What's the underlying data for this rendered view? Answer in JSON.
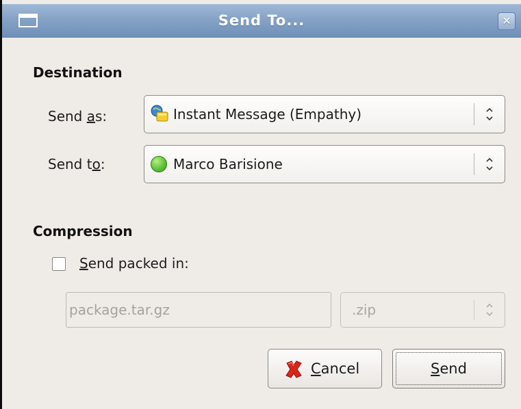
{
  "window": {
    "title": "Send To..."
  },
  "destination": {
    "heading": "Destination",
    "send_as": {
      "label_before": "Send ",
      "label_mnemonic": "a",
      "label_after": "s:",
      "value": "Instant Message (Empathy)",
      "icon": "instant-message-icon"
    },
    "send_to": {
      "label_before": "Send t",
      "label_mnemonic": "o",
      "label_after": ":",
      "value": "Marco Barisione",
      "icon": "status-available-icon",
      "status_color": "#5fc33a"
    }
  },
  "compression": {
    "heading": "Compression",
    "checkbox": {
      "label_mnemonic": "S",
      "label_after": "end packed in:",
      "checked": false
    },
    "filename_placeholder": "package.tar.gz",
    "format": ".zip"
  },
  "buttons": {
    "cancel": {
      "mnemonic": "C",
      "rest": "ancel",
      "icon": "cancel-icon"
    },
    "send": {
      "mnemonic": "S",
      "rest": "end"
    }
  },
  "colors": {
    "titlebar": "#86a3c6",
    "dialog_background": "#efebe7",
    "cancel_icon": "#d9261c"
  }
}
